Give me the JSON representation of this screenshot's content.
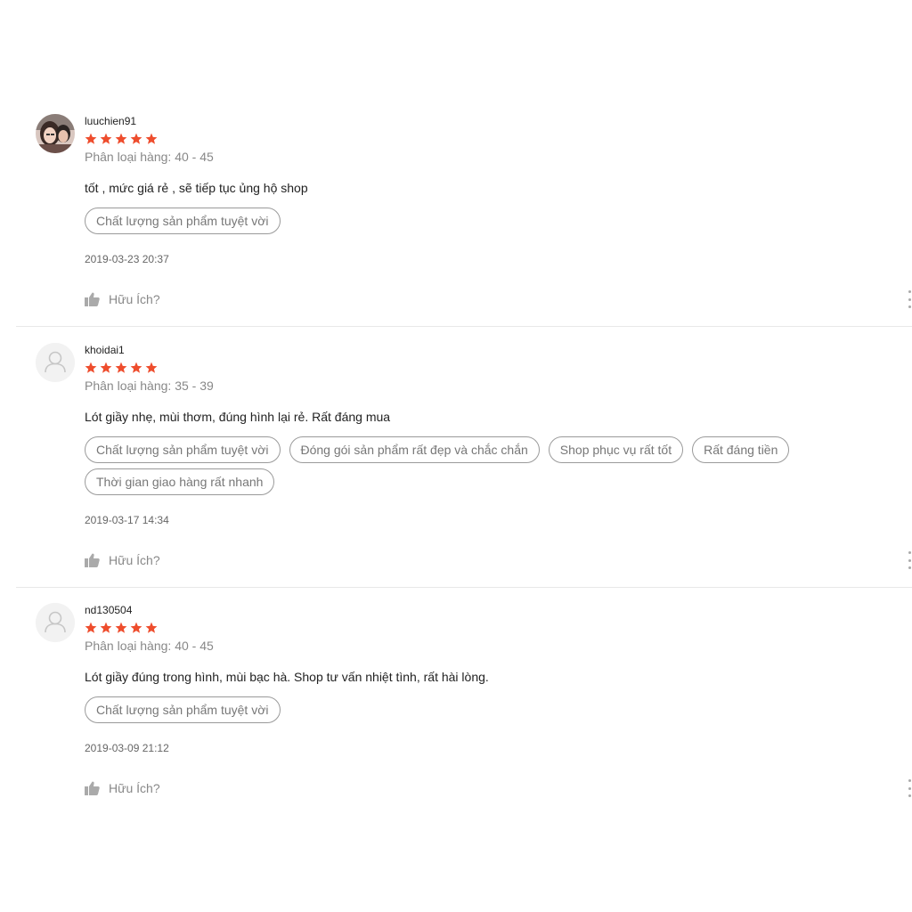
{
  "colors": {
    "star": "#ee4d2d",
    "tag_border": "#9a9a9a",
    "divider": "#e8e8e8"
  },
  "reviews": [
    {
      "username": "luuchien91",
      "rating": 5,
      "variation": "Phân loại hàng: 40 - 45",
      "comment": "tốt , mức giá rẻ , sẽ tiếp tục ủng hộ shop",
      "tags": [
        "Chất lượng sản phẩm tuyệt vời"
      ],
      "date": "2019-03-23 20:37",
      "helpful_label": "Hữu Ích?",
      "avatar_icon": "user-photo"
    },
    {
      "username": "khoidai1",
      "rating": 5,
      "variation": "Phân loại hàng: 35 - 39",
      "comment": "Lót giầy nhẹ, mùi thơm, đúng hình lại rẻ. Rất đáng mua",
      "tags": [
        "Chất lượng sản phẩm tuyệt vời",
        "Đóng gói sản phẩm rất đẹp và chắc chắn",
        "Shop phục vụ rất tốt",
        "Rất đáng tiền",
        "Thời gian giao hàng rất nhanh"
      ],
      "date": "2019-03-17 14:34",
      "helpful_label": "Hữu Ích?",
      "avatar_icon": "default-user-icon"
    },
    {
      "username": "nd130504",
      "rating": 5,
      "variation": "Phân loại hàng: 40 - 45",
      "comment": "Lót giầy đúng trong hình, mùi bạc hà. Shop tư vấn nhiệt tình, rất hài lòng.",
      "tags": [
        "Chất lượng sản phẩm tuyệt vời"
      ],
      "date": "2019-03-09 21:12",
      "helpful_label": "Hữu Ích?",
      "avatar_icon": "default-user-icon"
    }
  ]
}
